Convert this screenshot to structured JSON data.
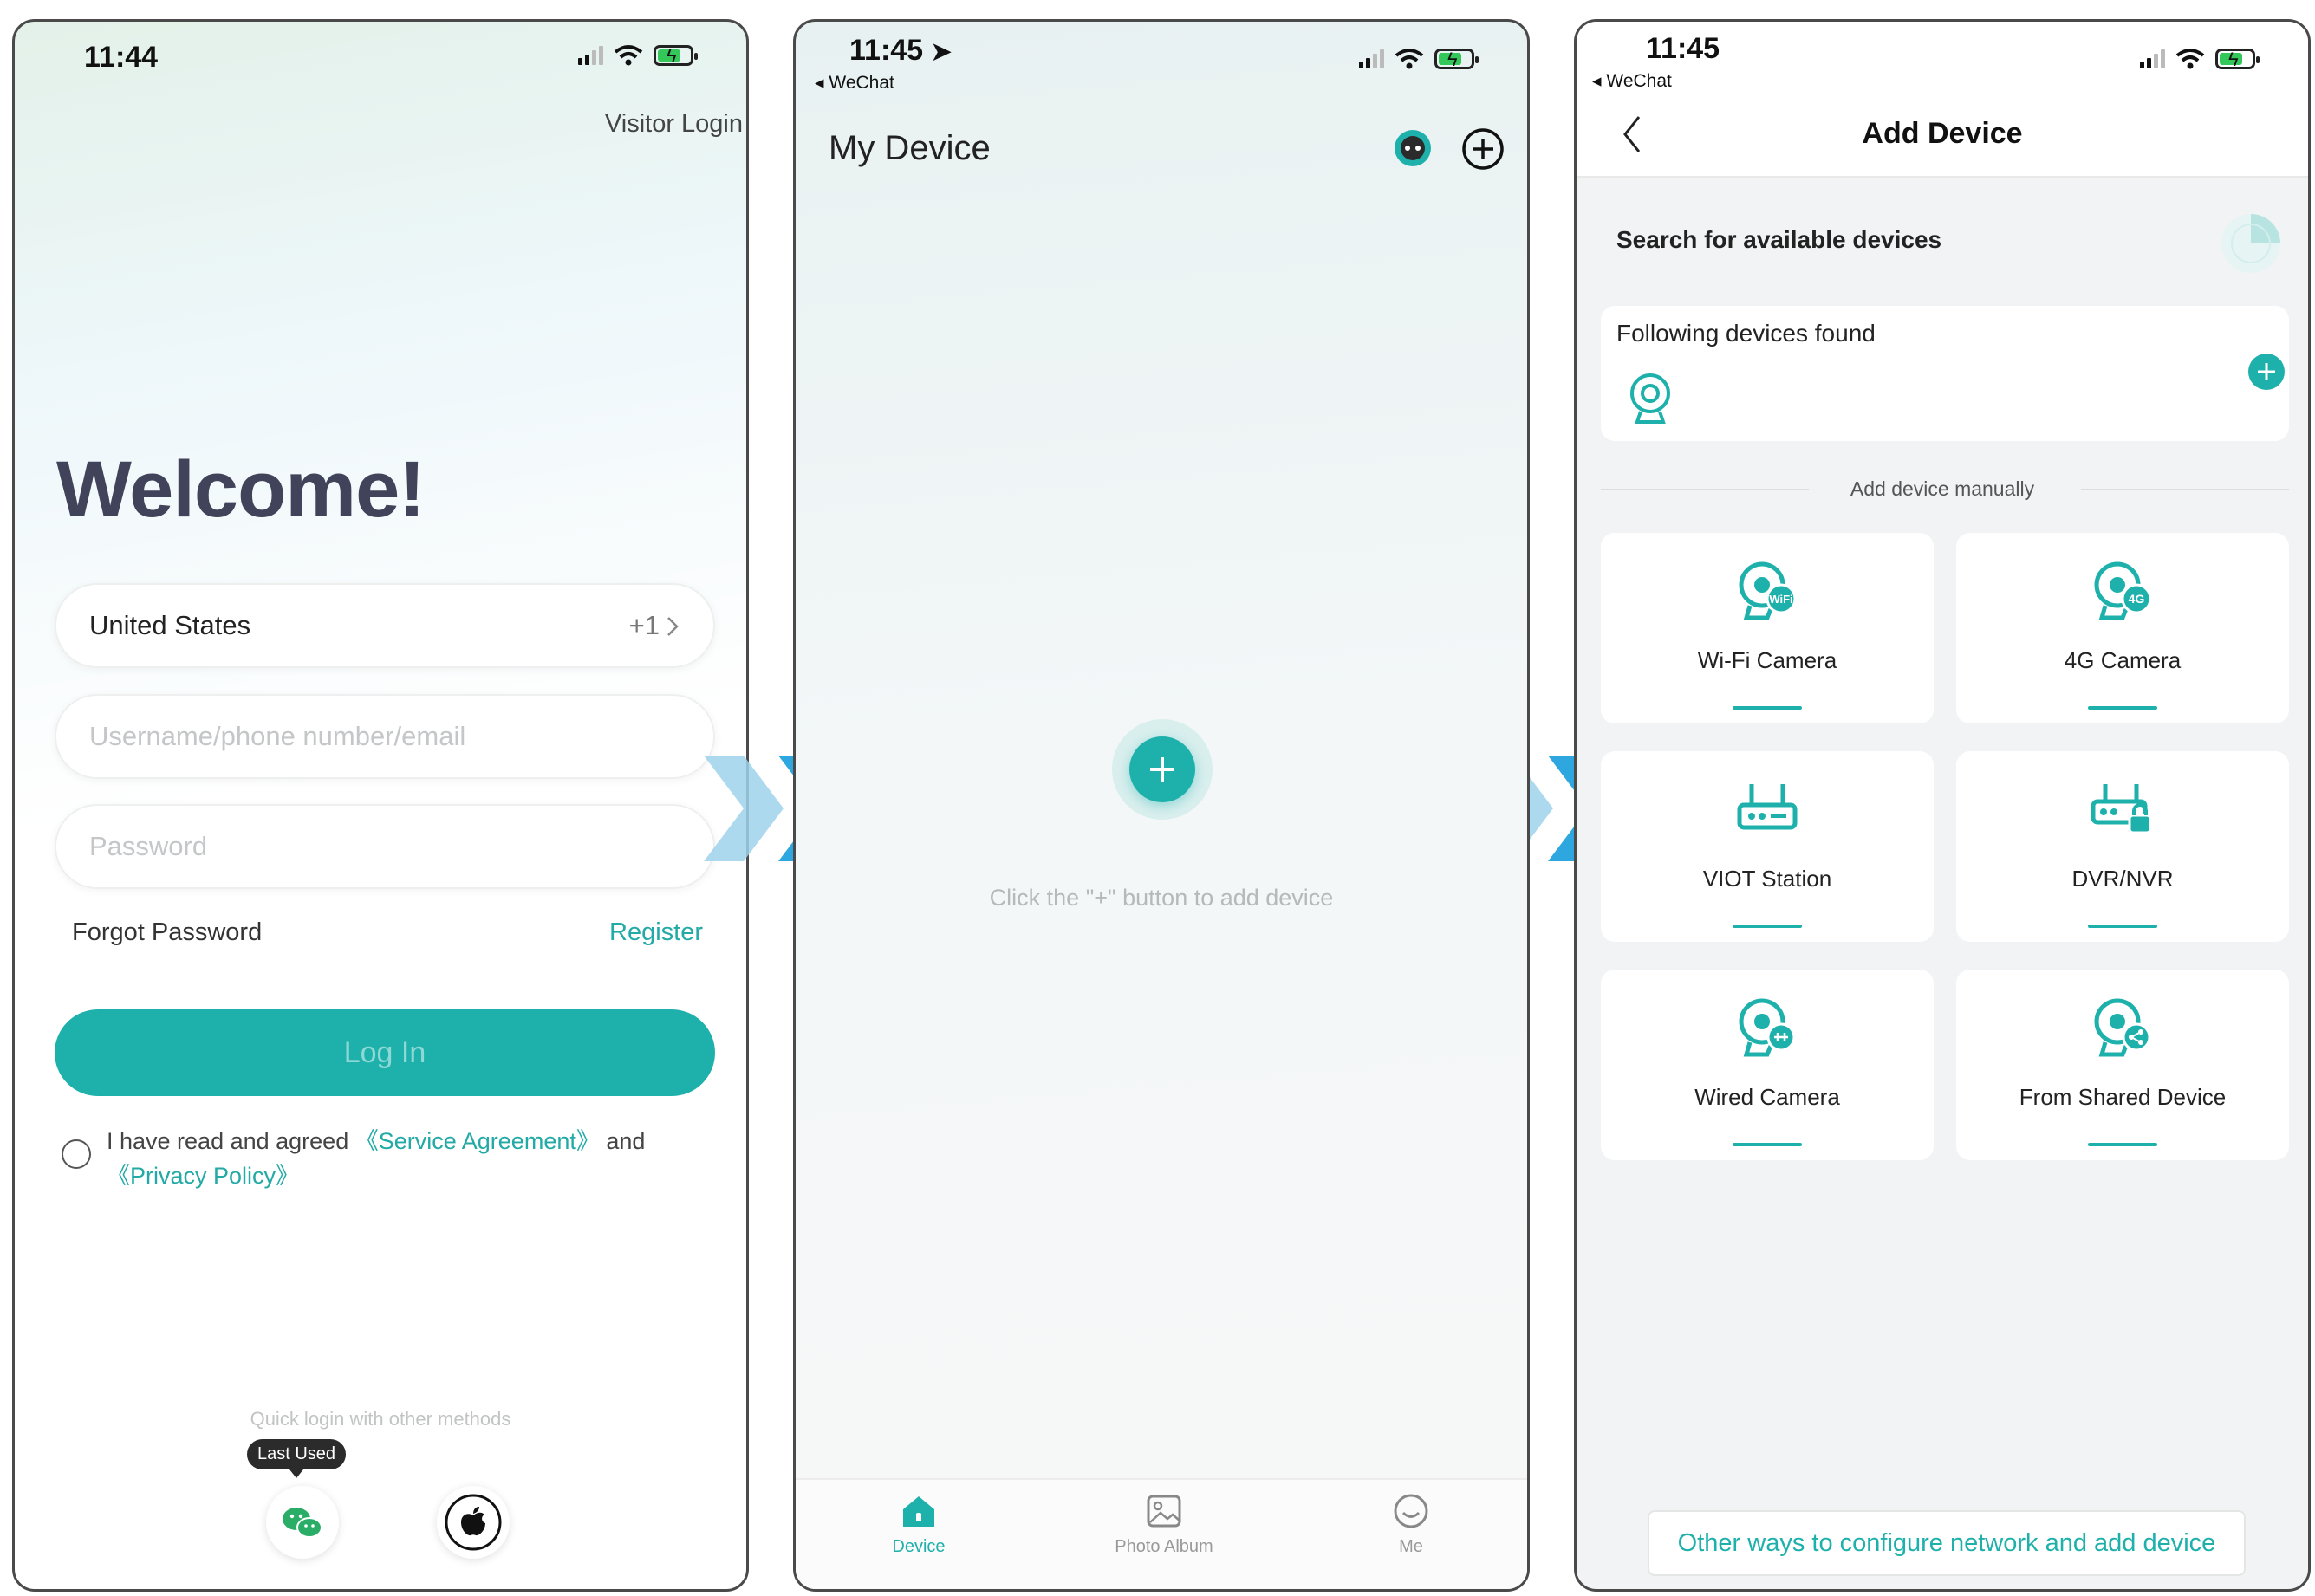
{
  "colors": {
    "accent": "#1eb1ac",
    "chevron_light": "#9fd2ec",
    "chevron_dark": "#2ea7e0"
  },
  "login": {
    "status_time": "11:44",
    "visitor_login": "Visitor Login",
    "welcome": "Welcome!",
    "country": "United States",
    "country_code": "+1",
    "username_placeholder": "Username/phone number/email",
    "password_placeholder": "Password",
    "forgot_password": "Forgot Password",
    "register": "Register",
    "login_button": "Log In",
    "agree_prefix": "I have read and agreed",
    "service_agreement": "《Service Agreement》",
    "agree_and": "and",
    "privacy_policy": "《Privacy Policy》",
    "quick_login": "Quick login with other methods",
    "last_used": "Last Used",
    "icons": [
      "wechat-icon",
      "apple-icon"
    ]
  },
  "device": {
    "status_time": "11:45",
    "status_back": "◂ WeChat",
    "title": "My Device",
    "empty_hint": "Click the \"+\" button to add device",
    "tabs": [
      {
        "label": "Device",
        "icon": "home-icon",
        "active": true
      },
      {
        "label": "Photo Album",
        "icon": "photo-icon",
        "active": false
      },
      {
        "label": "Me",
        "icon": "smile-icon",
        "active": false
      }
    ]
  },
  "add_device": {
    "status_time": "11:45",
    "status_back": "◂ WeChat",
    "title": "Add Device",
    "search_label": "Search for available devices",
    "found_label": "Following devices found",
    "manual_label": "Add device manually",
    "tiles": [
      {
        "label": "Wi-Fi Camera",
        "icon": "wifi-camera-icon",
        "badge": "WiFi"
      },
      {
        "label": "4G Camera",
        "icon": "4g-camera-icon",
        "badge": "4G"
      },
      {
        "label": "VIOT Station",
        "icon": "station-icon"
      },
      {
        "label": "DVR/NVR",
        "icon": "dvr-icon"
      },
      {
        "label": "Wired Camera",
        "icon": "wired-camera-icon"
      },
      {
        "label": "From Shared Device",
        "icon": "shared-device-icon"
      }
    ],
    "other_ways": "Other ways to configure network and add device"
  }
}
